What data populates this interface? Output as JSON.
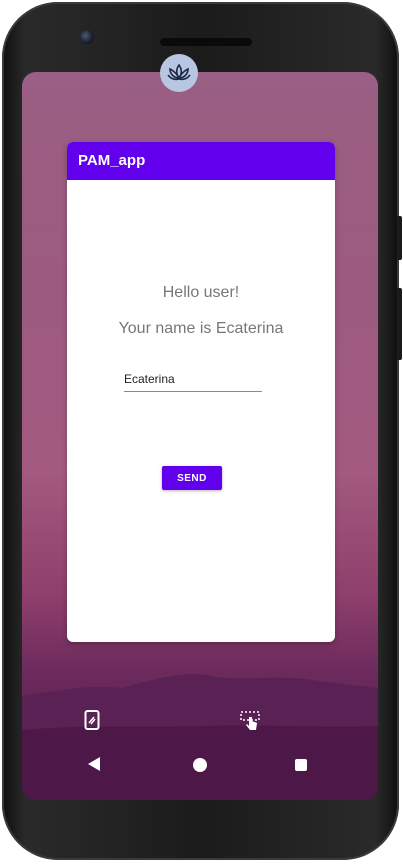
{
  "app": {
    "title": "PAM_app",
    "greeting": "Hello user!",
    "name_message": "Your name is Ecaterina",
    "name_input_value": "Ecaterina",
    "send_label": "SEND"
  },
  "colors": {
    "app_bar": "#6200ee",
    "button": "#6200ee",
    "text_gray": "#777777"
  },
  "icons": {
    "app": "lotus-icon",
    "dock_left": "phone-icon",
    "dock_right": "gesture-icon",
    "nav_back": "back-icon",
    "nav_home": "home-icon",
    "nav_recent": "recent-apps-icon"
  }
}
